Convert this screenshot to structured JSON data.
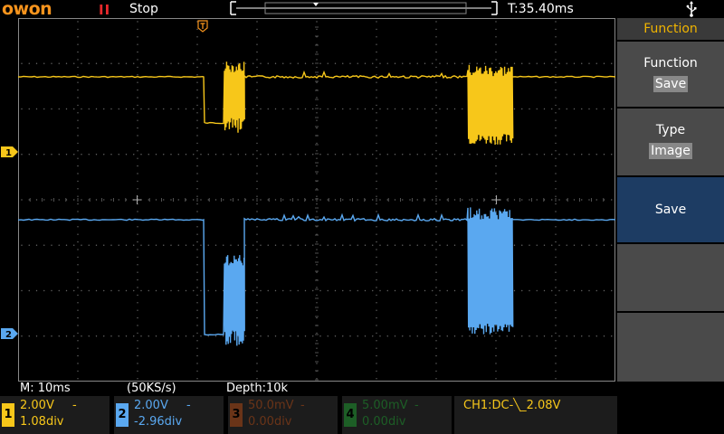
{
  "header": {
    "logo": "owon",
    "run_state": "Stop",
    "time_offset": "T:35.40ms"
  },
  "colors": {
    "ch1": "#f7c71a",
    "ch2": "#5aa8f0",
    "ch3": "#a04820",
    "ch4": "#2aa040",
    "logo": "#f7941d",
    "panel_active": "#1d3c63"
  },
  "icons": {
    "run": "pause-bars-icon",
    "usb": "usb-icon",
    "trigger_position": "trigger-t-marker-icon"
  },
  "menu": {
    "title": "Function",
    "items": [
      {
        "label": "Function",
        "value": "Save"
      },
      {
        "label": "Type",
        "value": "Image"
      },
      {
        "label": "Save",
        "value": ""
      },
      {
        "label": "",
        "value": ""
      },
      {
        "label": "",
        "value": ""
      }
    ]
  },
  "status": {
    "timebase": "M: 10ms",
    "sample_rate": "(50KS/s)",
    "depth": "Depth:10k"
  },
  "channels": [
    {
      "num": "1",
      "scale": "2.00V",
      "coupling": "-",
      "position": "1.08div"
    },
    {
      "num": "2",
      "scale": "2.00V",
      "coupling": "-",
      "position": "-2.96div"
    },
    {
      "num": "3",
      "scale": "50.0mV",
      "coupling": "-",
      "position": "0.00div"
    },
    {
      "num": "4",
      "scale": "5.00mV",
      "coupling": "-",
      "position": "0.00div"
    }
  ],
  "trigger": {
    "info": "CH1:DC-╲_2.08V"
  }
}
